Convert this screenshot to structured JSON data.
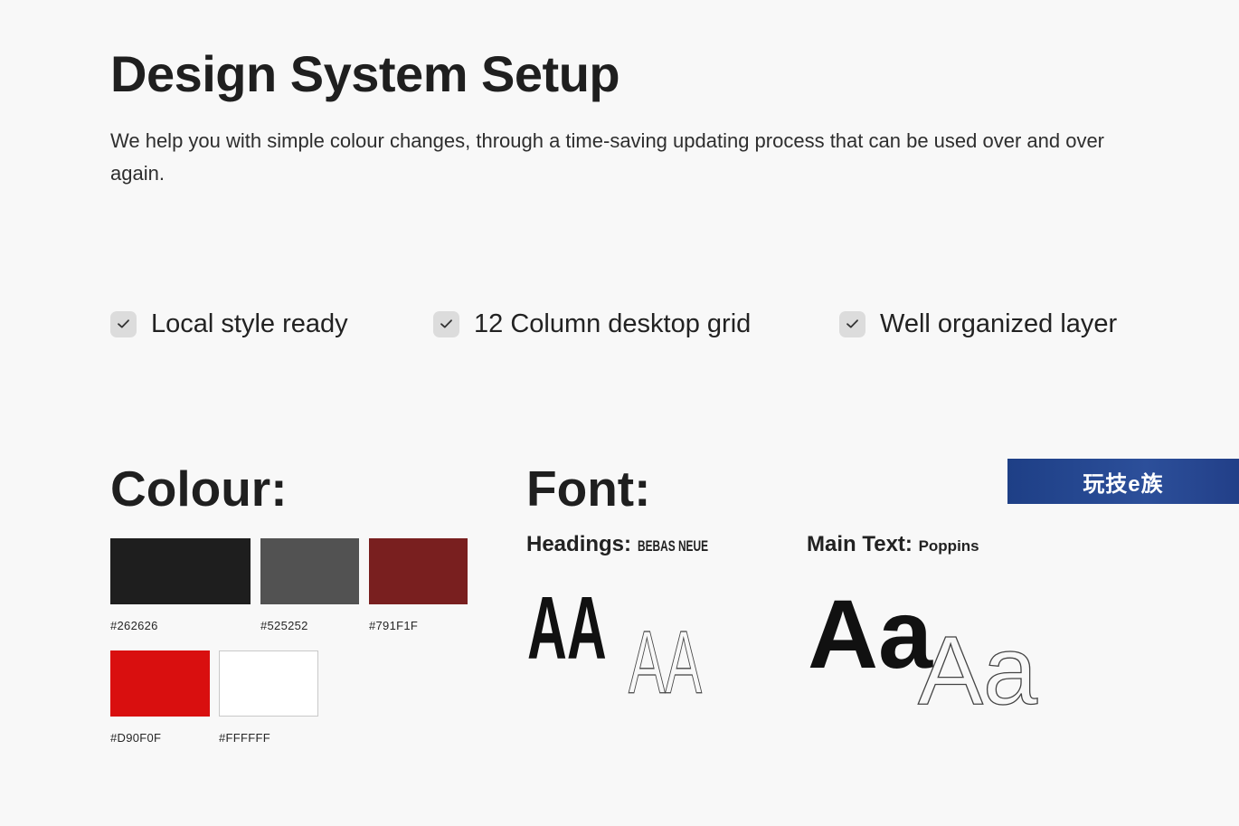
{
  "header": {
    "title": "Design System Setup",
    "subtitle": "We help you with simple colour changes, through a time-saving updating process that can be used over and over again."
  },
  "features": [
    {
      "label": "Local style ready"
    },
    {
      "label": "12 Column desktop grid"
    },
    {
      "label": "Well organized layer"
    }
  ],
  "colour_section": {
    "heading": "Colour:",
    "swatches": [
      {
        "code": "#262626",
        "hex": "#1e1e1e"
      },
      {
        "code": "#525252",
        "hex": "#525252"
      },
      {
        "code": "#791F1F",
        "hex": "#791f1f"
      },
      {
        "code": "#D90F0F",
        "hex": "#d90f0f"
      },
      {
        "code": "#FFFFFF",
        "hex": "#ffffff"
      }
    ]
  },
  "font_section": {
    "heading": "Font:",
    "headings_label": "Headings:",
    "headings_font": "BEBAS NEUE",
    "headings_sample": "AA",
    "main_label": "Main Text:",
    "main_font": "Poppins",
    "main_sample": "Aa"
  },
  "watermark": {
    "text": "玩技e族"
  },
  "icons": {
    "check": "check-icon"
  }
}
